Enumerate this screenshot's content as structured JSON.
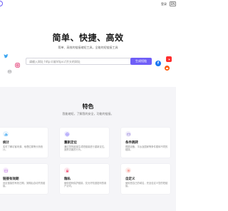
{
  "header": {
    "login_label": "登录",
    "lang_label": "EN"
  },
  "hero": {
    "title": "简单、快捷、高效",
    "subtitle": "简单、高效的链接缩短工具，全能的短链接工具",
    "url_placeholder": "请输入网址 http://或https://开头的网址",
    "shorten_label": "生成短链"
  },
  "social_icons": [
    "twitter-icon",
    "instagram-icon",
    "email-icon",
    "youtube-icon",
    "facebook-icon",
    "reddit-icon"
  ],
  "features": {
    "title": "特色",
    "subtitle": "我能缩短，了解我的安全，功能的链接。",
    "cards": [
      {
        "icon": "stats-icon",
        "title": "统计",
        "desc": "实时了解访客来源、地理位置等分析统计。",
        "color": "#3aa5f0"
      },
      {
        "icon": "target-icon",
        "title": "重新定位",
        "desc": "通过您的链接生成短链接进行重新定位，追踪访客的行为。",
        "color": "#6f5ef7"
      },
      {
        "icon": "browser-icon",
        "title": "条件跳转",
        "desc": "根据设备、平台及国家等条件跳转不同的链接。",
        "color": "#9c8bdc"
      },
      {
        "icon": "calendar-icon",
        "title": "链接有效期",
        "desc": "设定链接的有效日期，到期后自动失效链接。",
        "color": "#c78ae6"
      },
      {
        "icon": "lock-icon",
        "title": "隐私",
        "desc": "使用密码保护链接，仅允许知道密码的用户访问。",
        "color": "#f25a7a"
      },
      {
        "icon": "gear-icon",
        "title": "自定义",
        "desc": "使用您自己的域名，完全自定义您的短链接。",
        "color": "#f2746a"
      }
    ]
  }
}
